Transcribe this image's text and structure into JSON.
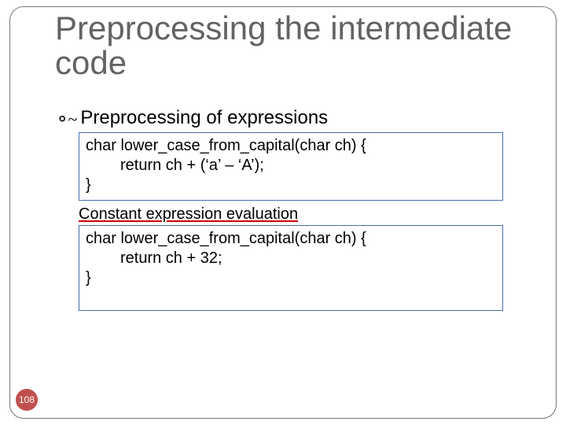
{
  "title": "Preprocessing the intermediate code",
  "bullet": "Preprocessing of expressions",
  "code1": {
    "l1": "char lower_case_from_capital(char ch) {",
    "l2": "return ch + (‘a’ – ‘A’);",
    "l3": "}"
  },
  "annotation": "Constant expression evaluation",
  "code2": {
    "l1": "char lower_case_from_capital(char ch) {",
    "l2": "return ch + 32;",
    "l3": "}"
  },
  "page_number": "108"
}
